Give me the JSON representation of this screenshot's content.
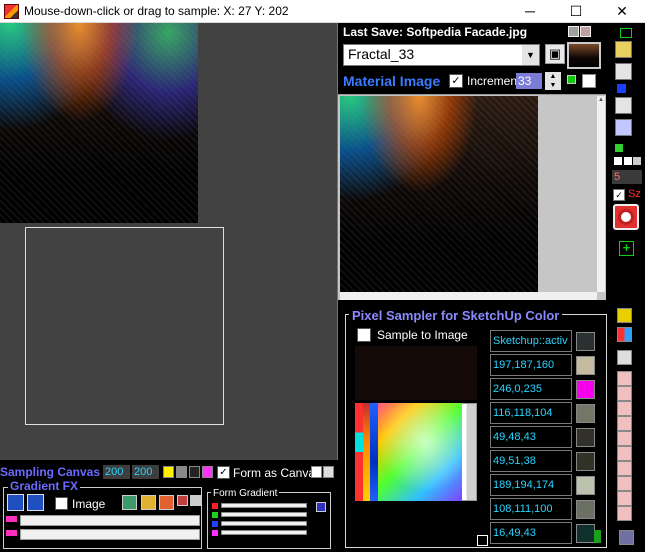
{
  "window": {
    "title": "Mouse-down-click or drag to sample: X: 27  Y: 202",
    "minimize": "─",
    "maximize": "☐",
    "close": "✕"
  },
  "material": {
    "last_save_label": "Last Save: Softpedia Facade.jpg",
    "selected": "Fractal_33",
    "material_image_label": "Material Image",
    "material_image_checked": true,
    "increment_label": "Increment",
    "increment_value": "33"
  },
  "toolbar": {
    "num_value": "5",
    "sz_label": "Sz",
    "plus_label": "+"
  },
  "sampler": {
    "title": "Pixel Sampler for SketchUp Color",
    "sample_to_image_label": "Sample to Image",
    "colors": [
      {
        "text": "Sketchup::activ",
        "swatch": "#2b3130"
      },
      {
        "text": "197,187,160",
        "swatch": "#c5bba0"
      },
      {
        "text": "246,0,235",
        "swatch": "#f600eb"
      },
      {
        "text": "116,118,104",
        "swatch": "#747668"
      },
      {
        "text": "49,48,43",
        "swatch": "#31302b"
      },
      {
        "text": "49,51,38",
        "swatch": "#313326"
      },
      {
        "text": "189,194,174",
        "swatch": "#bdc2ae"
      },
      {
        "text": "108,111,100",
        "swatch": "#6c6f64"
      },
      {
        "text": "16,49,43",
        "swatch": "#10312b"
      }
    ]
  },
  "canvas": {
    "label": "Sampling Canvas",
    "width": "200",
    "height": "200",
    "form_as_canvas_label": "Form as Canvas",
    "form_as_canvas_checked": true
  },
  "gradient_fx": {
    "label": "Gradient FX",
    "image_label": "Image",
    "form_gradient_label": "Form Gradient"
  }
}
